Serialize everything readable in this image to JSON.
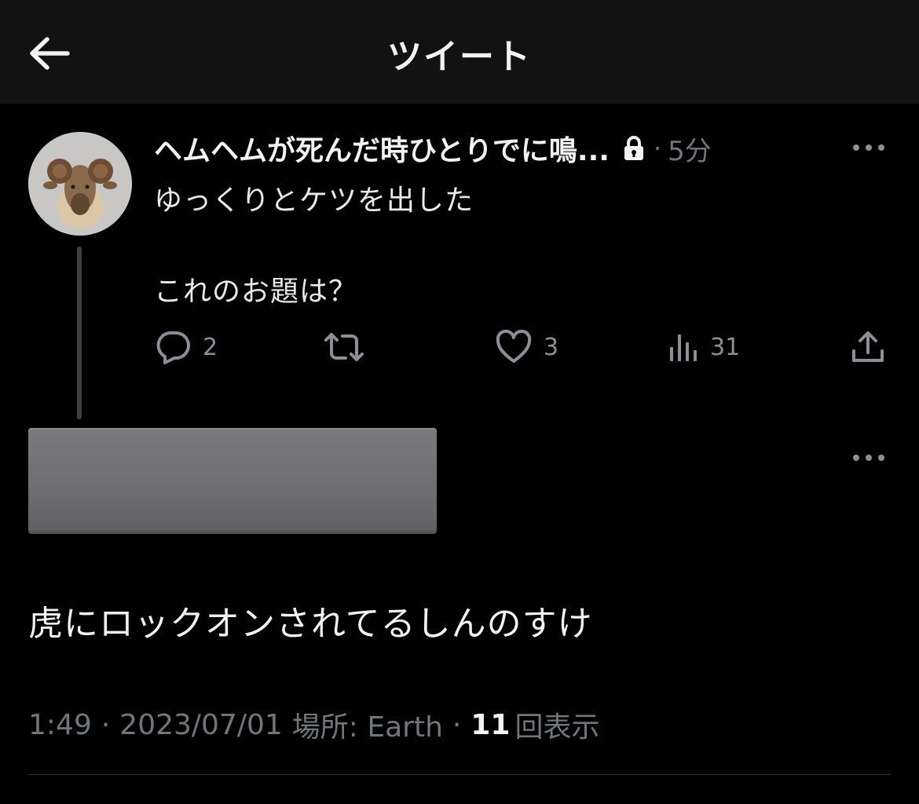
{
  "header": {
    "title": "ツイート"
  },
  "parent_tweet": {
    "display_name": "ヘムヘムが死んだ時ひとりでに鳴...",
    "separator": "·",
    "time_ago": "5分",
    "text_line1": "ゆっくりとケツを出した",
    "text_line2": "これのお題は？",
    "reply_count": "2",
    "like_count": "3",
    "view_count": "31"
  },
  "main_tweet": {
    "text": "虎にロックオンされてるしんのすけ",
    "time": "1:49",
    "sep1": "·",
    "date": "2023/07/01",
    "location_label": "場所: Earth",
    "sep2": "·",
    "views_count": "11",
    "views_label": "回表示"
  },
  "icons": {
    "back": "arrow-left-icon",
    "lock": "lock-icon",
    "more": "more-horizontal-icon",
    "reply": "reply-icon",
    "retweet": "retweet-icon",
    "like": "heart-icon",
    "views": "bar-chart-icon",
    "share": "share-icon"
  },
  "colors": {
    "background": "#000000",
    "header_bg": "#121212",
    "text_primary": "#e7e9ea",
    "text_secondary": "#71767b",
    "redaction": "#6e6e70"
  }
}
